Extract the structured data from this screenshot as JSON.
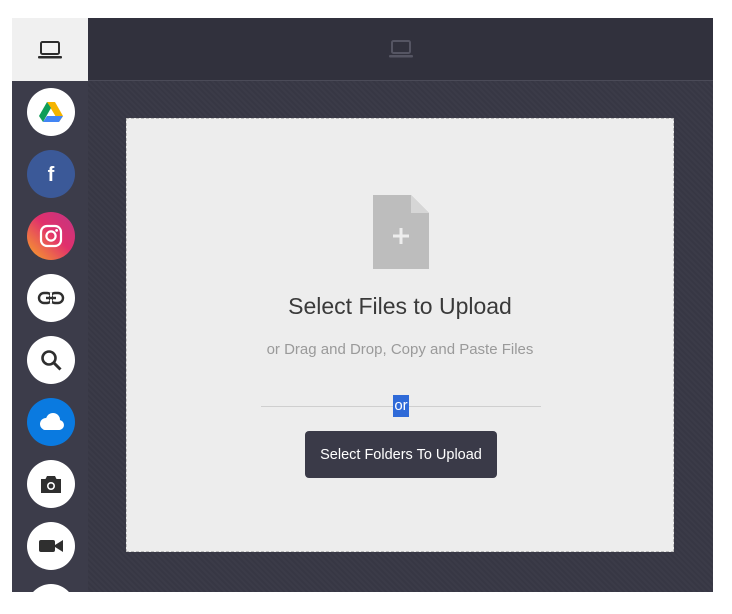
{
  "sidebar": {
    "active_source": "computer-icon",
    "sources": [
      {
        "name": "google-drive-icon",
        "color": "#ffffff"
      },
      {
        "name": "facebook-icon",
        "color": "#3b5998"
      },
      {
        "name": "instagram-icon",
        "color": "#e1306c"
      },
      {
        "name": "link-icon",
        "color": "#ffffff"
      },
      {
        "name": "search-icon",
        "color": "#ffffff"
      },
      {
        "name": "onedrive-icon",
        "color": "#0a7ae0"
      },
      {
        "name": "camera-icon",
        "color": "#ffffff"
      },
      {
        "name": "video-camera-icon",
        "color": "#ffffff"
      }
    ]
  },
  "header": {
    "icon": "computer-icon"
  },
  "dropzone": {
    "icon": "file-add-icon",
    "title": "Select Files to Upload",
    "subtitle": "or Drag and Drop, Copy and Paste Files",
    "separator": "or",
    "folder_button": "Select Folders To Upload"
  },
  "colors": {
    "sidebar_bg": "#3c3c4a",
    "main_bg": "#373744",
    "dropzone_bg": "#ededed",
    "button_bg": "#3a3a48",
    "selection": "#2f6ad8"
  }
}
